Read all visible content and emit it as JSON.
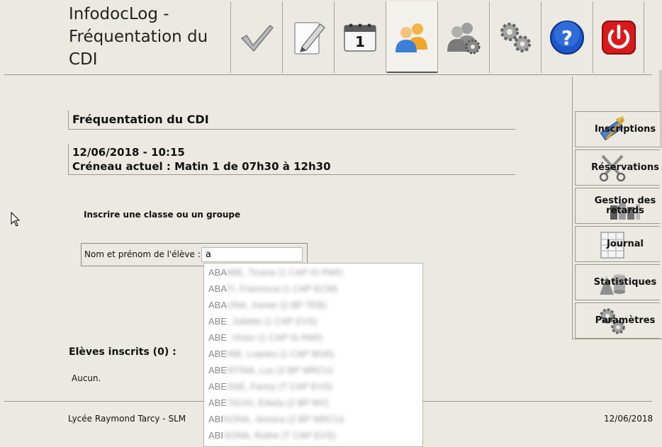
{
  "header": {
    "title": "InfodocLog - Fréquentation du CDI",
    "toolbar": [
      {
        "name": "check-icon"
      },
      {
        "name": "notepad-icon"
      },
      {
        "name": "calendar-icon",
        "label": "1"
      },
      {
        "name": "users-icon",
        "active": true
      },
      {
        "name": "users-settings-icon"
      },
      {
        "name": "gears-icon"
      },
      {
        "name": "help-icon",
        "label": "?"
      },
      {
        "name": "power-icon"
      }
    ]
  },
  "sidebar": {
    "items": [
      {
        "label": "Inscriptions",
        "icon": "pencil-ruler-icon"
      },
      {
        "label": "Réservations",
        "icon": "scissors-icon"
      },
      {
        "label": "Gestion des retards",
        "icon": "books-icon"
      },
      {
        "label": "Journal",
        "icon": "ledger-icon"
      },
      {
        "label": "Statistiques",
        "icon": "chart-shapes-icon"
      },
      {
        "label": "Paramètres",
        "icon": "gears-icon"
      }
    ]
  },
  "main": {
    "section_title": "Fréquentation du CDI",
    "datetime": "12/06/2018 - 10:15",
    "current_slot": "Créneau actuel : Matin 1 de 07h30 à 12h30",
    "register_subtitle": "Inscrire une classe ou un groupe",
    "student_field_label": "Nom et prénom de l'élève :",
    "student_field_value": "a",
    "enrolled_title": "Elèves inscrits (0) :",
    "enrolled_none": "Aucun."
  },
  "suggestions": [
    {
      "prefix": "ABA",
      "rest": "MIE, Ticana (1 CAP IS PAR)"
    },
    {
      "prefix": "ABA",
      "rest": "TI, Francisca (1 CAP ECM)"
    },
    {
      "prefix": "ABA",
      "rest": "UNA, Xavier (2 BP TEB)"
    },
    {
      "prefix": "ABE",
      "rest": ", Juliette (1 CAP EVS)"
    },
    {
      "prefix": "ABE",
      "rest": ", Victor (1 CAP IS PAR)"
    },
    {
      "prefix": "ABE",
      "rest": "NIE, Loanks (1 CAP MVA)"
    },
    {
      "prefix": "ABE",
      "rest": "NTINA, Luc (2 BP MRCU)"
    },
    {
      "prefix": "ABE",
      "rest": "SSE, Fanny (T CAP EVS)"
    },
    {
      "prefix": "ABE",
      "rest": "TAUVI, Erkely (2 BP MV)"
    },
    {
      "prefix": "ABI",
      "rest": "KONA, Jessica (2 BP MRCU)"
    },
    {
      "prefix": "ABI",
      "rest": "SONA, Ruthe (T CAP EVS)"
    }
  ],
  "footer": {
    "school": "Lycée Raymond Tarcy - SLM",
    "date": "12/06/2018"
  }
}
